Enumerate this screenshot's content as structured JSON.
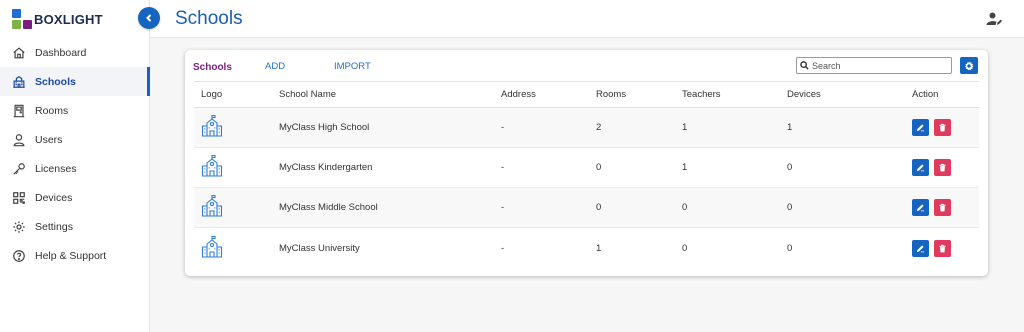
{
  "brand": {
    "name": "BOXLIGHT",
    "colors": {
      "blue": "#1e6fd0",
      "green": "#7cb342",
      "purple": "#7b1e7e",
      "navy": "#1d2b4f"
    }
  },
  "sidebar": {
    "items": [
      {
        "label": "Dashboard",
        "icon": "home-icon",
        "active": false
      },
      {
        "label": "Schools",
        "icon": "school-building-icon",
        "active": true
      },
      {
        "label": "Rooms",
        "icon": "door-icon",
        "active": false
      },
      {
        "label": "Users",
        "icon": "user-icon",
        "active": false
      },
      {
        "label": "Licenses",
        "icon": "key-icon",
        "active": false
      },
      {
        "label": "Devices",
        "icon": "qr-grid-icon",
        "active": false
      },
      {
        "label": "Settings",
        "icon": "gear-icon",
        "active": false
      },
      {
        "label": "Help & Support",
        "icon": "help-circle-icon",
        "active": false
      }
    ]
  },
  "header": {
    "title": "Schools",
    "user_icon": "user-edit-icon"
  },
  "card": {
    "tabs": {
      "schools": "Schools",
      "add": "ADD",
      "import": "IMPORT"
    },
    "search": {
      "placeholder": "Search",
      "value": ""
    },
    "settings_icon": "gear-icon"
  },
  "table": {
    "columns": {
      "logo": "Logo",
      "name": "School Name",
      "address": "Address",
      "rooms": "Rooms",
      "teachers": "Teachers",
      "devices": "Devices",
      "action": "Action"
    },
    "rows": [
      {
        "name": "MyClass High School",
        "address": "-",
        "rooms": "2",
        "teachers": "1",
        "devices": "1"
      },
      {
        "name": "MyClass Kindergarten",
        "address": "-",
        "rooms": "0",
        "teachers": "1",
        "devices": "0"
      },
      {
        "name": "MyClass Middle School",
        "address": "-",
        "rooms": "0",
        "teachers": "0",
        "devices": "0"
      },
      {
        "name": "MyClass University",
        "address": "-",
        "rooms": "1",
        "teachers": "0",
        "devices": "0"
      }
    ]
  },
  "colors": {
    "primary": "#1565c0",
    "danger": "#e03a5f",
    "title": "#1b5fb0",
    "tab_active": "#7b1e7e"
  }
}
